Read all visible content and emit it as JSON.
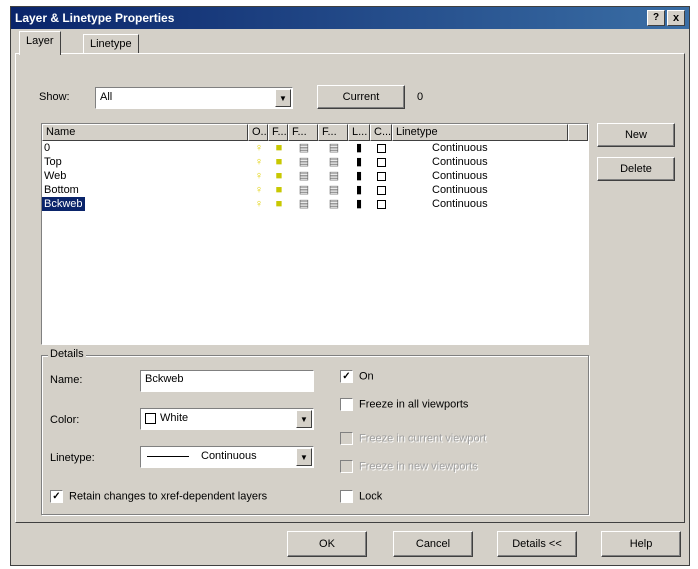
{
  "window": {
    "title": "Layer & Linetype Properties",
    "help_glyph": "?",
    "close_glyph": "x"
  },
  "tabs": [
    {
      "label": "Layer",
      "active": true
    },
    {
      "label": "Linetype",
      "active": false
    }
  ],
  "show": {
    "label": "Show:",
    "value": "All"
  },
  "current": {
    "button_label": "Current",
    "value": "0"
  },
  "columns": [
    "Name",
    "O...",
    "F...",
    "F...",
    "F...",
    "L...",
    "C...",
    "Linetype"
  ],
  "layers": [
    {
      "name": "0",
      "linetype": "Continuous",
      "selected": false
    },
    {
      "name": "Top",
      "linetype": "Continuous",
      "selected": false
    },
    {
      "name": "Web",
      "linetype": "Continuous",
      "selected": false
    },
    {
      "name": "Bottom",
      "linetype": "Continuous",
      "selected": false
    },
    {
      "name": "Bckweb",
      "linetype": "Continuous",
      "selected": true
    }
  ],
  "side_buttons": {
    "new": "New",
    "delete": "Delete"
  },
  "details": {
    "legend": "Details",
    "name_label": "Name:",
    "name_value": "Bckweb",
    "color_label": "Color:",
    "color_value": "White",
    "linetype_label": "Linetype:",
    "linetype_value": "Continuous",
    "retain_label": "Retain changes to xref-dependent layers",
    "retain_checked": true,
    "on_label": "On",
    "on_checked": true,
    "freeze_all_label": "Freeze in all viewports",
    "freeze_current_label": "Freeze in current viewport",
    "freeze_new_label": "Freeze in new viewports",
    "lock_label": "Lock"
  },
  "footer": {
    "ok": "OK",
    "cancel": "Cancel",
    "details": "Details <<",
    "help": "Help"
  },
  "colors": {
    "title_start": "#0a246a",
    "title_end": "#3a6ea5",
    "dialog_bg": "#d4d0c8",
    "selection": "#0a246a",
    "bulb": "#e0d000"
  },
  "icons": {
    "on": "lightbulb-icon",
    "freeze": "sun-icon",
    "freeze_vp": "freeze-viewport-icon",
    "lock": "unlocked-padlock-icon",
    "color": "color-swatch-icon"
  }
}
